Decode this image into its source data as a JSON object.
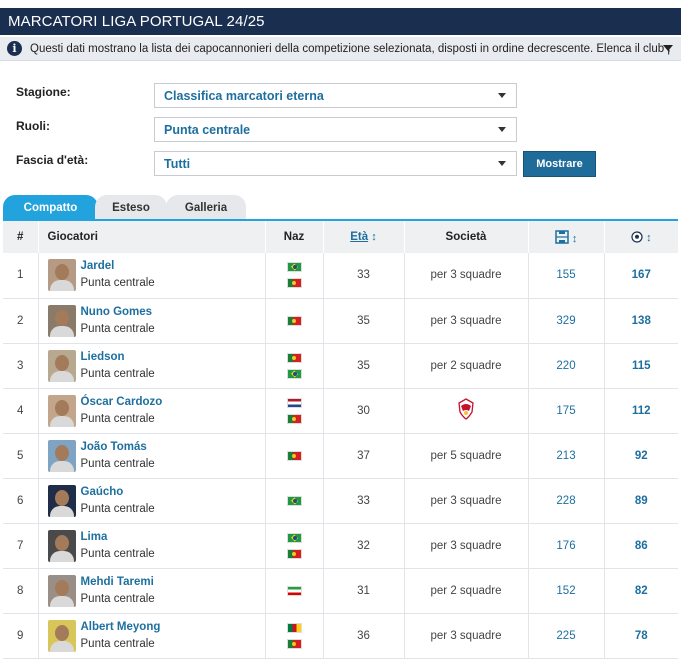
{
  "title": "MARCATORI LIGA PORTUGAL 24/25",
  "info": "Questi dati mostrano la lista dei capocannonieri della competizione selezionata, disposti in ordine decrescente. Elenca il club per il quale il gio...",
  "filters": {
    "season_label": "Stagione:",
    "season_value": "Classifica marcatori eterna",
    "role_label": "Ruoli:",
    "role_value": "Punta centrale",
    "age_label": "Fascia d'età:",
    "age_value": "Tutti",
    "show_button": "Mostrare"
  },
  "tabs": [
    "Compatto",
    "Esteso",
    "Galleria"
  ],
  "columns": {
    "num": "#",
    "player": "Giocatori",
    "naz": "Naz",
    "age": "Età",
    "club": "Società"
  },
  "icons": {
    "appearances": "lineup-icon",
    "goals": "football-icon",
    "sort": "sort-arrows-icon"
  },
  "colors": {
    "header": "#1a2e50",
    "accent": "#22a3dd",
    "link": "#1d6f9f"
  },
  "rows": [
    {
      "num": "1",
      "name": "Jardel",
      "role": "Punta centrale",
      "flags": [
        "brazil-flag",
        "portugal-flag"
      ],
      "age": "33",
      "club": "per 3 squadre",
      "apps": "155",
      "goals": "167"
    },
    {
      "num": "2",
      "name": "Nuno Gomes",
      "role": "Punta centrale",
      "flags": [
        "portugal-flag"
      ],
      "age": "35",
      "club": "per 3 squadre",
      "apps": "329",
      "goals": "138"
    },
    {
      "num": "3",
      "name": "Liedson",
      "role": "Punta centrale",
      "flags": [
        "portugal-flag",
        "brazil-flag"
      ],
      "age": "35",
      "club": "per 2 squadre",
      "apps": "220",
      "goals": "115"
    },
    {
      "num": "4",
      "name": "Óscar Cardozo",
      "role": "Punta centrale",
      "flags": [
        "netherlands-flag",
        "portugal-flag"
      ],
      "age": "30",
      "club": "",
      "club_icon": "benfica-crest-icon",
      "apps": "175",
      "goals": "112"
    },
    {
      "num": "5",
      "name": "João Tomás",
      "role": "Punta centrale",
      "flags": [
        "portugal-flag"
      ],
      "age": "37",
      "club": "per 5 squadre",
      "apps": "213",
      "goals": "92"
    },
    {
      "num": "6",
      "name": "Gaúcho",
      "role": "Punta centrale",
      "flags": [
        "brazil-flag"
      ],
      "age": "33",
      "club": "per 3 squadre",
      "apps": "228",
      "goals": "89"
    },
    {
      "num": "7",
      "name": "Lima",
      "role": "Punta centrale",
      "flags": [
        "brazil-flag",
        "portugal-flag"
      ],
      "age": "32",
      "club": "per 3 squadre",
      "apps": "176",
      "goals": "86"
    },
    {
      "num": "8",
      "name": "Mehdi Taremi",
      "role": "Punta centrale",
      "flags": [
        "iran-flag"
      ],
      "age": "31",
      "club": "per 2 squadre",
      "apps": "152",
      "goals": "82"
    },
    {
      "num": "9",
      "name": "Albert Meyong",
      "role": "Punta centrale",
      "flags": [
        "cameroon-flag",
        "portugal-flag"
      ],
      "age": "36",
      "club": "per 3 squadre",
      "apps": "225",
      "goals": "78"
    }
  ]
}
